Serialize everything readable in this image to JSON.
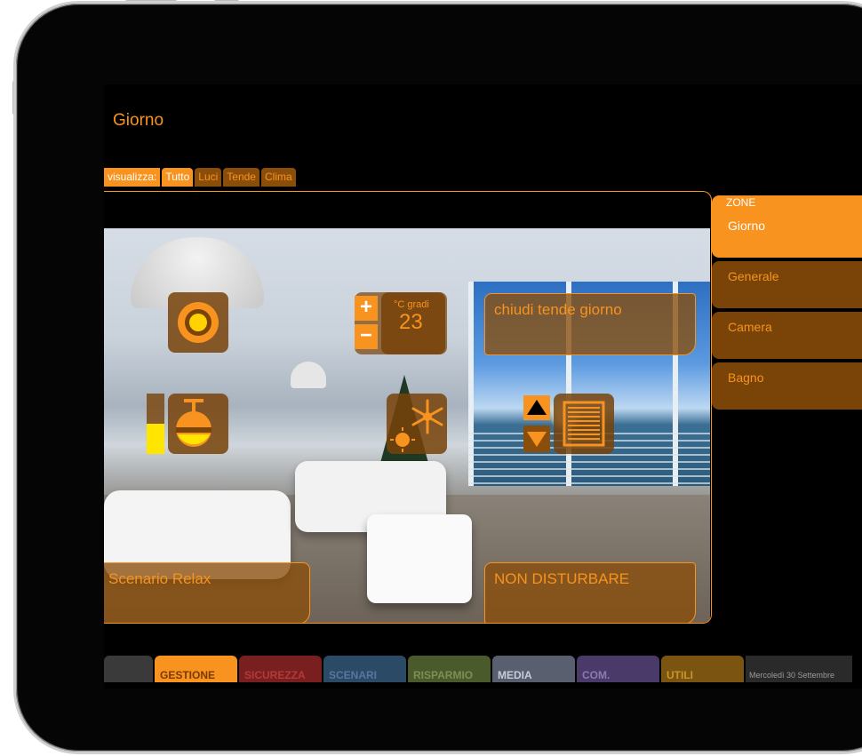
{
  "app": {
    "page_title": "Giorno"
  },
  "filter": {
    "label": "visualizza:",
    "tabs": [
      {
        "label": "Tutto",
        "active": true
      },
      {
        "label": "Luci",
        "active": false
      },
      {
        "label": "Tende",
        "active": false
      },
      {
        "label": "Clima",
        "active": false
      }
    ]
  },
  "controls": {
    "light_icon": "light-bulb-icon",
    "dimmer_icon": "pendant-lamp-icon",
    "dimmer_level": 0.5,
    "temperature": {
      "unit_label": "°C gradi",
      "value": "23",
      "plus": "+",
      "minus": "−"
    },
    "climate_icon": "snowflake-sun-icon",
    "blind_icon": "blind-icon",
    "scenario_close_blinds": "chiudi tende giorno",
    "scenario_relax": "Scenario Relax",
    "scenario_dnd": "NON DISTURBARE"
  },
  "zones": {
    "header": "ZONE",
    "items": [
      {
        "label": "Giorno",
        "active": true
      },
      {
        "label": "Generale",
        "active": false
      },
      {
        "label": "Camera",
        "active": false
      },
      {
        "label": "Bagno",
        "active": false
      }
    ]
  },
  "bottom_nav": {
    "tabs": [
      {
        "label": "",
        "color": "#3a3a3a",
        "text_color": "#555555"
      },
      {
        "label": "GESTIONE",
        "color": "#f7931e",
        "text_color": "#7a3a00"
      },
      {
        "label": "SICUREZZA",
        "color": "#7a1f1f",
        "text_color": "#b33a3a"
      },
      {
        "label": "SCENARI",
        "color": "#2b4a66",
        "text_color": "#5677a0"
      },
      {
        "label": "RISPARMIO",
        "color": "#4a5a2a",
        "text_color": "#7e8f55"
      },
      {
        "label": "MEDIA",
        "color": "#5a5f70",
        "text_color": "#c8ccd8"
      },
      {
        "label": "COM.",
        "color": "#4a3a6a",
        "text_color": "#8a7ab0"
      },
      {
        "label": "UTILI",
        "color": "#7a5410",
        "text_color": "#c9952a"
      }
    ],
    "date": "Mercoledì 30 Settembre"
  },
  "colors": {
    "accent": "#f7931e",
    "accent_dark": "#7a4408"
  }
}
